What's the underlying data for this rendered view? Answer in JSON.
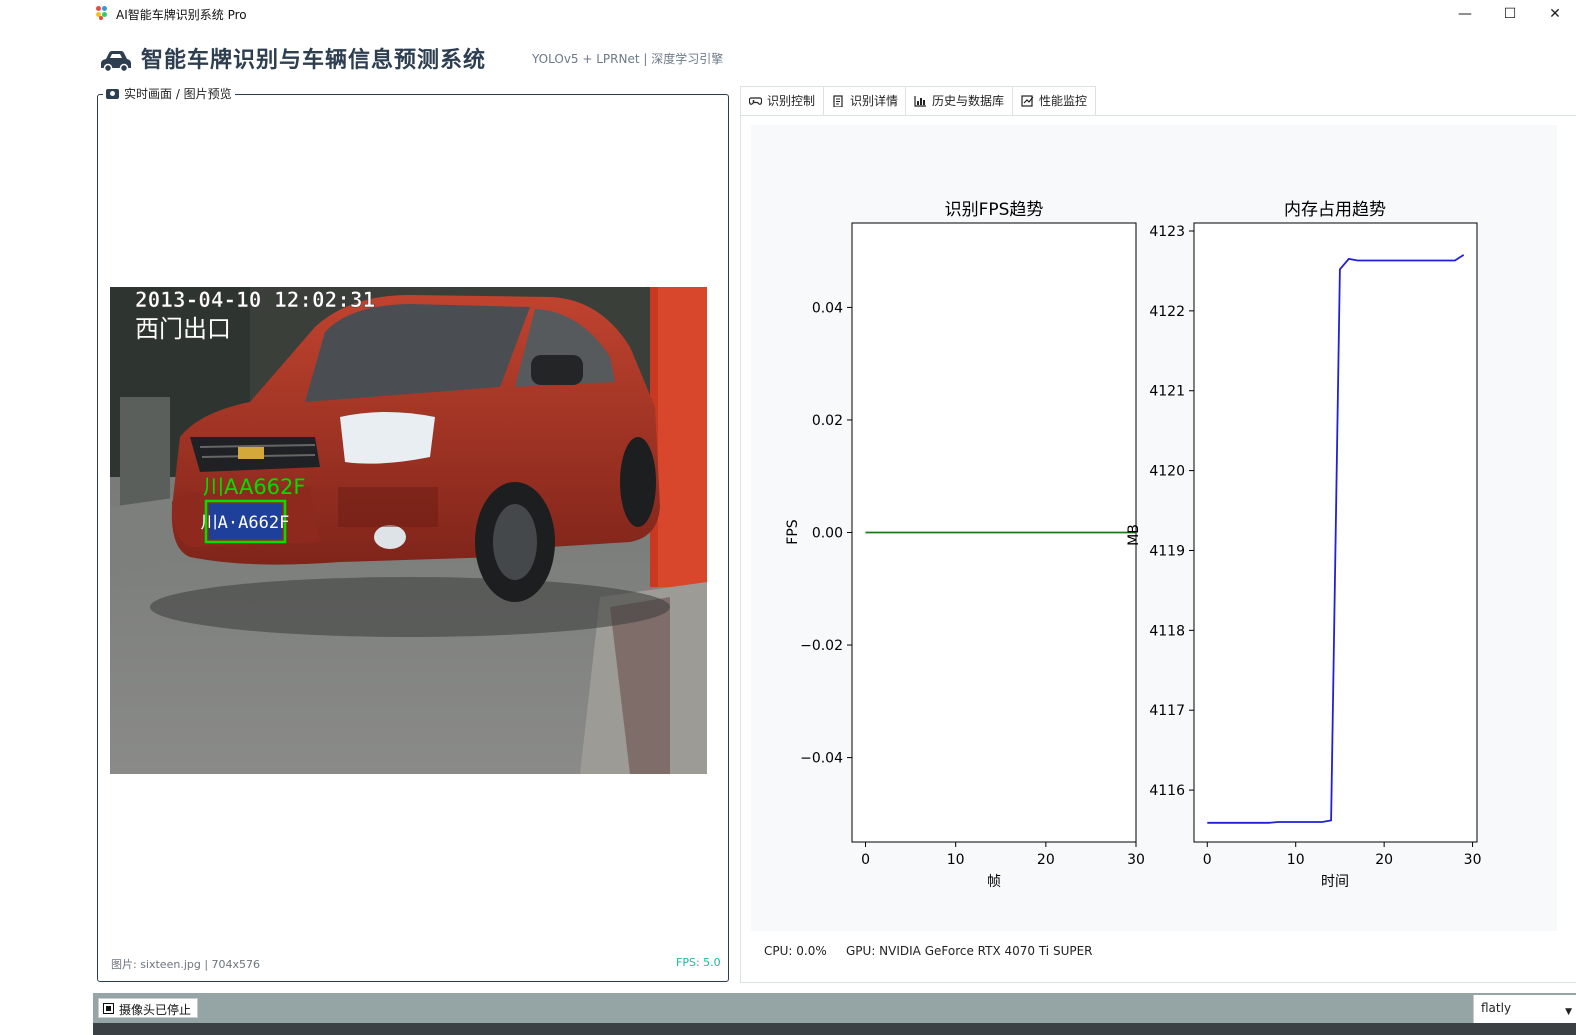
{
  "window": {
    "title": "AI智能车牌识别系统 Pro",
    "minimize_glyph": "—",
    "maximize_glyph": "☐",
    "close_glyph": "✕"
  },
  "header": {
    "title": "智能车牌识别与车辆信息预测系统",
    "subtitle": "YOLOv5 + LPRNet | 深度学习引擎",
    "icon": "car-icon"
  },
  "preview": {
    "legend": "实时画面 / 图片预览",
    "legend_icon": "camera-icon",
    "overlay_datetime": "2013-04-10 12:02:31",
    "overlay_location": "西门出口",
    "detected_plate": "川AA662F",
    "plate_text": "川A·A662F",
    "image_info": "图片: sixteen.jpg | 704x576",
    "fps": "FPS: 5.0"
  },
  "tabs": [
    {
      "label": "识别控制",
      "icon": "gamepad-icon",
      "active": false
    },
    {
      "label": "识别详情",
      "icon": "clipboard-icon",
      "active": false
    },
    {
      "label": "历史与数据库",
      "icon": "bar-chart-icon",
      "active": false
    },
    {
      "label": "性能监控",
      "icon": "check-chart-icon",
      "active": true
    }
  ],
  "performance": {
    "cpu": "CPU: 0.0%",
    "gpu": "GPU: NVIDIA GeForce RTX 4070 Ti SUPER"
  },
  "status": {
    "camera_button": "摄像头已停止",
    "theme": "flatly"
  },
  "colors": {
    "primary": "#2c3e50",
    "success": "#18bc9c",
    "statusbar": "#95a5a6",
    "fps_line": "#1a7a1a",
    "mem_line": "#1f1fdd",
    "plate_box": "#00e000"
  },
  "chart_data": [
    {
      "type": "line",
      "title": "识别FPS趋势",
      "xlabel": "帧",
      "ylabel": "FPS",
      "xlim": [
        -1.5,
        30
      ],
      "ylim": [
        -0.055,
        0.055
      ],
      "xticks": [
        0,
        10,
        20,
        30
      ],
      "yticks": [
        0.04,
        0.02,
        0.0,
        -0.02,
        -0.04
      ],
      "ytick_labels": [
        "0.04",
        "0.02",
        "0.00",
        "−0.02",
        "−0.04"
      ],
      "x": [
        0,
        1,
        2,
        3,
        4,
        5,
        6,
        7,
        8,
        9,
        10,
        11,
        12,
        13,
        14,
        15,
        16,
        17,
        18,
        19,
        20,
        21,
        22,
        23,
        24,
        25,
        26,
        27,
        28,
        29,
        30
      ],
      "values": [
        0,
        0,
        0,
        0,
        0,
        0,
        0,
        0,
        0,
        0,
        0,
        0,
        0,
        0,
        0,
        0,
        0,
        0,
        0,
        0,
        0,
        0,
        0,
        0,
        0,
        0,
        0,
        0,
        0,
        0,
        0
      ]
    },
    {
      "type": "line",
      "title": "内存占用趋势",
      "xlabel": "时间",
      "ylabel": "MB",
      "xlim": [
        -1.5,
        30.5
      ],
      "ylim": [
        4115.35,
        4123.1
      ],
      "xticks": [
        0,
        10,
        20,
        30
      ],
      "yticks": [
        4123,
        4122,
        4121,
        4120,
        4119,
        4118,
        4117,
        4116
      ],
      "ytick_labels": [
        "4123",
        "4122",
        "4121",
        "4120",
        "4119",
        "4118",
        "4117",
        "4116"
      ],
      "x": [
        0,
        1,
        2,
        3,
        4,
        5,
        6,
        7,
        8,
        9,
        10,
        11,
        12,
        13,
        14,
        15,
        16,
        17,
        18,
        19,
        20,
        21,
        22,
        23,
        24,
        25,
        26,
        27,
        28,
        29
      ],
      "values": [
        4115.59,
        4115.59,
        4115.59,
        4115.59,
        4115.59,
        4115.59,
        4115.59,
        4115.59,
        4115.6,
        4115.6,
        4115.6,
        4115.6,
        4115.6,
        4115.6,
        4115.62,
        4122.52,
        4122.65,
        4122.63,
        4122.63,
        4122.63,
        4122.63,
        4122.63,
        4122.63,
        4122.63,
        4122.63,
        4122.63,
        4122.63,
        4122.63,
        4122.63,
        4122.7
      ]
    }
  ]
}
